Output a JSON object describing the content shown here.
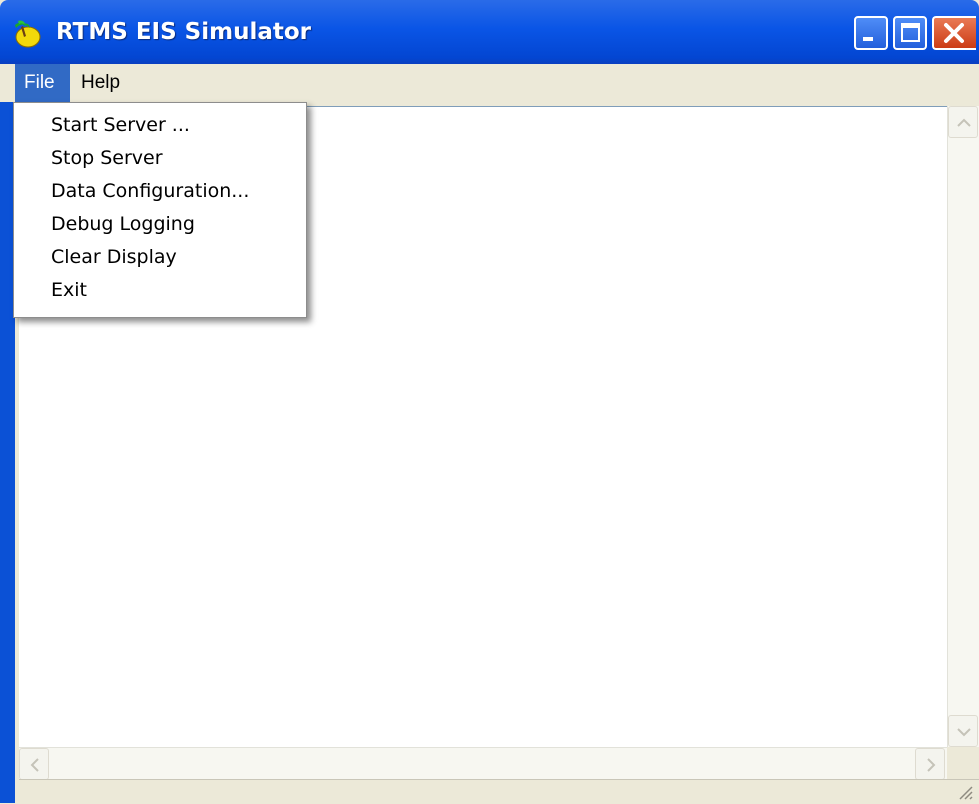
{
  "window": {
    "title": "RTMS EIS Simulator",
    "app_icon": "palm-tree-icon",
    "controls": [
      "minimize-icon",
      "maximize-icon",
      "close-icon"
    ]
  },
  "menubar": {
    "items": [
      {
        "label": "File",
        "active": true
      },
      {
        "label": "Help",
        "active": false
      }
    ]
  },
  "file_menu": {
    "items": [
      {
        "label": "Start Server ..."
      },
      {
        "label": "Stop Server"
      },
      {
        "label": "Data Configuration..."
      },
      {
        "label": "Debug Logging"
      },
      {
        "label": "Clear Display"
      },
      {
        "label": "Exit"
      }
    ]
  },
  "main": {
    "log_text": ""
  },
  "colors": {
    "titlebar": "#0a55e6",
    "menu_highlight": "#316ac5",
    "close_button": "#d9531c"
  }
}
